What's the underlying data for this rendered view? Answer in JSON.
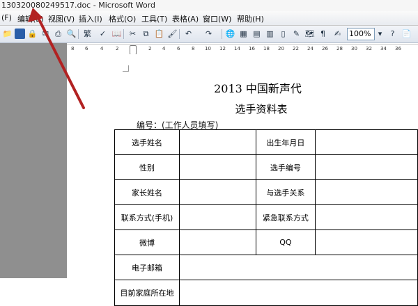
{
  "window": {
    "title": "130320080249517.doc - Microsoft Word"
  },
  "menu": [
    {
      "label": "(F)"
    },
    {
      "label": "编辑(E)"
    },
    {
      "label": "视图(V)"
    },
    {
      "label": "插入(I)"
    },
    {
      "label": "格式(O)"
    },
    {
      "label": "工具(T)"
    },
    {
      "label": "表格(A)"
    },
    {
      "label": "窗口(W)"
    },
    {
      "label": "帮助(H)"
    }
  ],
  "toolbar": {
    "zoom": "100%"
  },
  "ruler": {
    "ticks": [
      "8",
      "6",
      "4",
      "2",
      "2",
      "4",
      "6",
      "8",
      "10",
      "12",
      "14",
      "16",
      "18",
      "20",
      "22",
      "24",
      "26",
      "28",
      "30",
      "32",
      "34",
      "36"
    ]
  },
  "document": {
    "title": "2013 中国新声代",
    "subtitle": "选手资料表",
    "number_label": "编号：(工作人员填写) ___________",
    "form": {
      "contestant_name": "选手姓名",
      "birth_date": "出生年月日",
      "gender": "性别",
      "contestant_number": "选手编号",
      "parent_name": "家长姓名",
      "relation": "与选手关系",
      "contact_phone": "联系方式(手机)",
      "emergency_contact": "紧急联系方式",
      "weibo": "微博",
      "qq": "QQ",
      "email": "电子邮箱",
      "address": "目前家庭所在地"
    }
  },
  "annotation": {
    "arrow_color": "#b22222"
  }
}
